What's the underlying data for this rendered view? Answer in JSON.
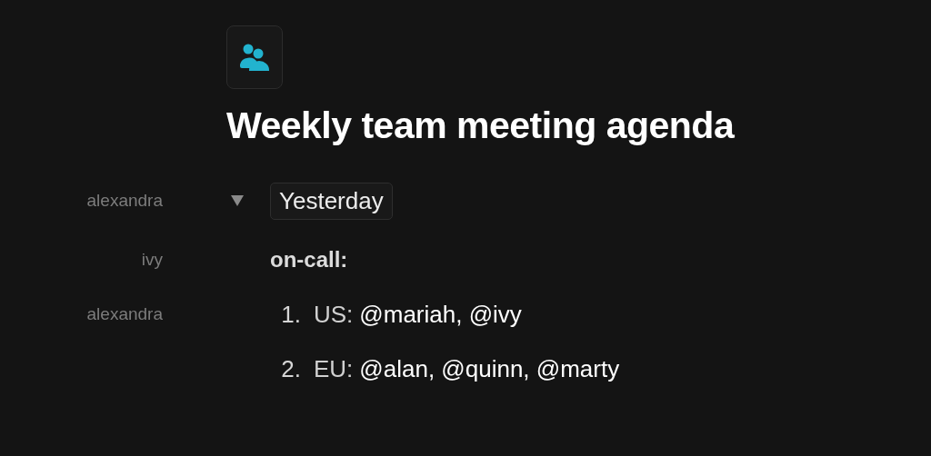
{
  "page": {
    "title": "Weekly team meeting agenda"
  },
  "blocks": [
    {
      "kind": "toggle",
      "author": "alexandra",
      "text": "Yesterday",
      "expanded": true
    },
    {
      "kind": "heading",
      "author": "ivy",
      "text": "on-call:"
    },
    {
      "kind": "list_item",
      "author": "alexandra",
      "number": "1.",
      "label": "US:",
      "mentions": "@mariah, @ivy"
    },
    {
      "kind": "list_item",
      "number": "2.",
      "label": "EU:",
      "mentions": "@alan, @quinn, @marty"
    }
  ]
}
